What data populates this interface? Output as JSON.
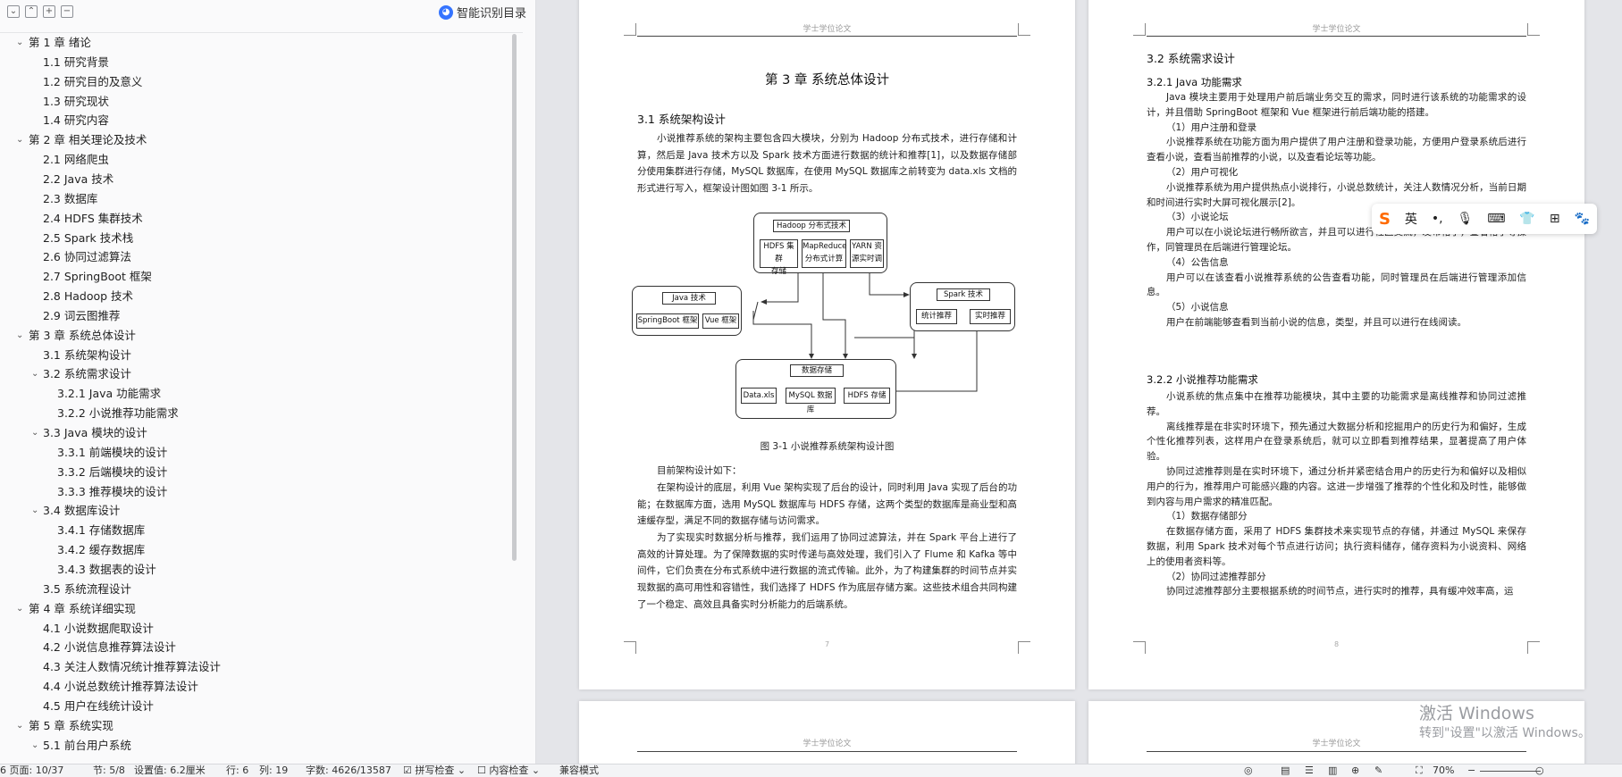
{
  "nav": {
    "toolbar_icons": [
      "collapse-all-icon",
      "expand-all-icon",
      "add-heading-icon",
      "remove-heading-icon"
    ],
    "smart_toc_label": "智能识别目录",
    "tree": [
      {
        "level": 1,
        "expanded": true,
        "label": "第 1 章  绪论"
      },
      {
        "level": 2,
        "label": "1.1    研究背景"
      },
      {
        "level": 2,
        "label": "1.2    研究目的及意义"
      },
      {
        "level": 2,
        "label": "1.3    研究现状"
      },
      {
        "level": 2,
        "label": "1.4    研究内容"
      },
      {
        "level": 1,
        "expanded": true,
        "label": "第 2 章    相关理论及技术"
      },
      {
        "level": 2,
        "label": "2.1    网络爬虫"
      },
      {
        "level": 2,
        "label": "2.2    Java 技术"
      },
      {
        "level": 2,
        "label": "2.3    数据库"
      },
      {
        "level": 2,
        "label": "2.4    HDFS 集群技术"
      },
      {
        "level": 2,
        "label": "2.5    Spark 技术栈"
      },
      {
        "level": 2,
        "label": "2.6    协同过滤算法"
      },
      {
        "level": 2,
        "label": "2.7    SpringBoot 框架"
      },
      {
        "level": 2,
        "label": "2.8    Hadoop 技术"
      },
      {
        "level": 2,
        "label": "2.9    词云图推荐"
      },
      {
        "level": 1,
        "expanded": true,
        "label": "第 3 章    系统总体设计"
      },
      {
        "level": 2,
        "label": "3.1    系统架构设计"
      },
      {
        "level": 2,
        "expanded": true,
        "label": "3.2    系统需求设计"
      },
      {
        "level": 3,
        "label": "3.2.1    Java 功能需求"
      },
      {
        "level": 3,
        "label": "3.2.2    小说推荐功能需求"
      },
      {
        "level": 2,
        "expanded": true,
        "label": "3.3    Java 模块的设计"
      },
      {
        "level": 3,
        "label": "3.3.1    前端模块的设计"
      },
      {
        "level": 3,
        "label": "3.3.2    后端模块的设计"
      },
      {
        "level": 3,
        "label": "3.3.3    推荐模块的设计"
      },
      {
        "level": 2,
        "expanded": true,
        "label": "3.4    数据库设计"
      },
      {
        "level": 3,
        "label": "3.4.1    存储数据库"
      },
      {
        "level": 3,
        "label": "3.4.2    缓存数据库"
      },
      {
        "level": 3,
        "label": "3.4.3    数据表的设计"
      },
      {
        "level": 2,
        "label": "3.5    系统流程设计"
      },
      {
        "level": 1,
        "expanded": true,
        "label": "第 4 章    系统详细实现"
      },
      {
        "level": 2,
        "label": "4.1    小说数据爬取设计"
      },
      {
        "level": 2,
        "label": "4.2    小说信息推荐算法设计"
      },
      {
        "level": 2,
        "label": "4.3    关注人数情况统计推荐算法设计"
      },
      {
        "level": 2,
        "label": "4.4    小说总数统计推荐算法设计"
      },
      {
        "level": 2,
        "label": "4.5    用户在线统计设计"
      },
      {
        "level": 1,
        "expanded": true,
        "label": "第 5 章    系统实现"
      },
      {
        "level": 2,
        "expanded": true,
        "label": "5.1    前台用户系统"
      }
    ]
  },
  "doc": {
    "header_text": "学士学位论文",
    "left_page": {
      "chapter_title": "第 3 章    系统总体设计",
      "section_title": "3.1    系统架构设计",
      "paragraph1": "小说推荐系统的架构主要包含四大模块，分别为 Hadoop 分布式技术，进行存储和计算，然后是 Java 技术方以及 Spark 技术方面进行数据的统计和推荐[1]，以及数据存储部分使用集群进行存储，MySQL 数据库，在使用 MySQL 数据库之前转变为 data.xls 文档的形式进行写入，框架设计图如图 3-1 所示。",
      "figure_caption": "图 3-1  小说推荐系统架构设计图",
      "paragraph2": "目前架构设计如下：",
      "paragraph3": "在架构设计的底层，利用 Vue 架构实现了后台的设计，同时利用 Java 实现了后台的功能；在数据库方面，选用 MySQL 数据库与 HDFS 存储，这两个类型的数据库是商业型和高速缓存型，满足不同的数据存储与访问需求。",
      "paragraph4": "为了实现实时数据分析与推荐，我们运用了协同过滤算法，并在 Spark 平台上进行了高效的计算处理。为了保障数据的实时传递与高效处理，我们引入了 Flume 和 Kafka 等中间件，它们负责在分布式系统中进行数据的流式传输。此外，为了构建集群的时间节点并实现数据的高可用性和容错性，我们选择了 HDFS 作为底层存储方案。这些技术组合共同构建了一个稳定、高效且具备实时分析能力的后端系统。",
      "page_number": "7",
      "diagram": {
        "hadoop_title": "Hadoop 分布式技术",
        "hdfs_cluster": "HDFS 集群\n存储",
        "mapreduce": "MapReduce\n分布式计算",
        "yarn": "YARN 资\n源实时调",
        "java_title": "Java 技术",
        "springboot": "SpringBoot 框架",
        "vue": "Vue 框架",
        "spark_title": "Spark 技术",
        "stats": "统计推荐",
        "realtime": "实时推荐",
        "storage_title": "数据存储",
        "dataxls": "Data.xls",
        "mysql": "MySQL 数据库",
        "hdfs_store": "HDFS 存储"
      }
    },
    "right_page": {
      "section_title": "3.2    系统需求设计",
      "sub1": "3.2.1    Java 功能需求",
      "lines1": [
        "Java 模块主要用于处理用户前后端业务交互的需求，同时进行该系统的功能需求的设计，并且借助 SpringBoot 框架和 Vue 框架进行前后端功能的搭建。",
        "（1）用户注册和登录",
        "小说推荐系统在功能方面为用户提供了用户注册和登录功能，方便用户登录系统后进行查看小说，查看当前推荐的小说，以及查看论坛等功能。",
        "（2）用户可视化",
        "小说推荐系统为用户提供热点小说排行，小说总数统计，关注人数情况分析，当前日期和时间进行实时大屏可视化展示[2]。",
        "（3）小说论坛",
        "用户可以在小说论坛进行畅所欲言，并且可以进行社区交流，发布帖子，查看帖子等操作，同管理员在后端进行管理论坛。",
        "（4）公告信息",
        "用户可以在该查看小说推荐系统的公告查看功能，同时管理员在后端进行管理添加信息。",
        "（5）小说信息",
        "用户在前端能够查看到当前小说的信息，类型，并且可以进行在线阅读。"
      ],
      "sub2": "3.2.2    小说推荐功能需求",
      "lines2": [
        "小说系统的焦点集中在推荐功能模块，其中主要的功能需求是离线推荐和协同过滤推荐。",
        "离线推荐是在非实时环境下，预先通过大数据分析和挖掘用户的历史行为和偏好，生成个性化推荐列表，这样用户在登录系统后，就可以立即看到推荐结果，显著提高了用户体验。",
        "协同过滤推荐则是在实时环境下，通过分析并紧密结合用户的历史行为和偏好以及相似用户的行为，推荐用户可能感兴趣的内容。这进一步增强了推荐的个性化和及时性，能够做到内容与用户需求的精准匹配。",
        "（1）数据存储部分",
        "在数据存储方面，采用了 HDFS 集群技术来实现节点的存储，并通过 MySQL 来保存数据，利用 Spark 技术对每个节点进行访问；执行资料储存，储存资料为小说资料、网络上的使用者资料等。",
        "（2）协同过滤推荐部分",
        "协同过滤推荐部分主要根据系统的时间节点，进行实时的推荐，具有缓冲效率高，运"
      ],
      "page_number": "8"
    }
  },
  "ime": {
    "logo": "S",
    "lang": "英",
    "items": [
      "punct-icon",
      "mic-icon",
      "keyboard-icon",
      "skin-icon",
      "grid-icon",
      "mascot-icon"
    ]
  },
  "watermark": {
    "line1": "激活 Windows",
    "line2": "转到\"设置\"以激活 Windows。"
  },
  "status": {
    "page": "6   页面: 10/37",
    "section": "节: 5/8",
    "setting": "设置值: 6.2厘米",
    "row": "行: 6",
    "col": "列: 19",
    "words": "字数: 4626/13587",
    "spell": "拼写检查",
    "content_check": "内容检查",
    "compat": "兼容模式",
    "zoom": "70%"
  }
}
